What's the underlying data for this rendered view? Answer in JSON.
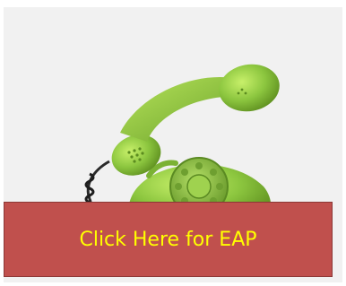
{
  "cta": {
    "label": "Click Here for EAP"
  },
  "image": {
    "subject": "green rotary telephone",
    "icon": "telephone-icon"
  },
  "colors": {
    "button_fill": "#c0504d",
    "button_text": "#ffff00",
    "background": "#f1f1f1",
    "phone_green": "#8cc63f"
  }
}
